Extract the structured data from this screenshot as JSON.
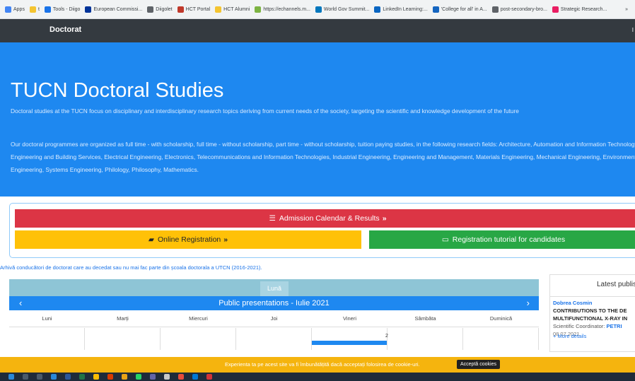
{
  "bookmarks": [
    {
      "label": "Apps",
      "icon": "apps-grid-icon",
      "color": "#4285f4"
    },
    {
      "label": "t",
      "icon": "folder-icon",
      "color": "#f4c430"
    },
    {
      "label": "Tools - Diigo",
      "icon": "diigo-icon",
      "color": "#1a73e8"
    },
    {
      "label": "European Commissi...",
      "icon": "eu-flag-icon",
      "color": "#003399"
    },
    {
      "label": "Diigolet",
      "icon": "globe-icon",
      "color": "#5f6368"
    },
    {
      "label": "HCT Portal",
      "icon": "hct-icon",
      "color": "#c0392b"
    },
    {
      "label": "HCT Alumni",
      "icon": "folder-icon",
      "color": "#f4c430"
    },
    {
      "label": "https://echannels.m...",
      "icon": "echannels-icon",
      "color": "#7cb342"
    },
    {
      "label": "World Gov Summit...",
      "icon": "wgs-icon",
      "color": "#0277bd"
    },
    {
      "label": "LinkedIn Learning:...",
      "icon": "linkedin-icon",
      "color": "#0a66c2"
    },
    {
      "label": "'College for all' in A...",
      "icon": "page-icon",
      "color": "#1565c0"
    },
    {
      "label": "post-secondary-bro...",
      "icon": "globe-icon",
      "color": "#5f6368"
    },
    {
      "label": "Strategic Research...",
      "icon": "strategic-icon",
      "color": "#e91e63"
    }
  ],
  "bookmarks_overflow": "»",
  "navbar": {
    "brand": "Doctorat",
    "edge": "I"
  },
  "hero": {
    "title": "TUCN Doctoral Studies",
    "intro": "Doctoral studies at the TUCN focus on disciplinary and interdisciplinary research topics deriving from current needs of the society, targeting the scientific and knowledge development of the future",
    "fields": "Our doctoral programmes are organized as full time - with scholarship, full time - without scholarship, part time - without scholarship, tuition paying studies, in the following research fields: Architecture, Automation and Information Technology, Civil Engineering and Building Services, Electrical Engineering, Electronics, Telecommunications and Information Technologies, Industrial Engineering, Engineering and Management, Materials Engineering, Mechanical Engineering, Environmental Engineering, Systems Engineering, Philology, Philosophy, Mathematics."
  },
  "buttons": {
    "admission": "Admission Calendar & Results",
    "online_registration": "Online Registration",
    "tutorial": "Registration tutorial for candidates",
    "chevrons": "»"
  },
  "archive_link": "Arhivă conducători de doctorat care au decedat sau nu mai fac parte din școala doctorala a UTCN (2016-2021).",
  "calendar": {
    "view_tab": "Lună",
    "title": "Public presentations - Iulie 2021",
    "prev": "‹",
    "next": "›",
    "weekdays": [
      "Luni",
      "Marți",
      "Miercuri",
      "Joi",
      "Vineri",
      "Sâmbăta",
      "Duminică"
    ],
    "visible_day": "2"
  },
  "latest": {
    "heading": "Latest publis",
    "author": "Dobrea Cosmin",
    "title_line1": "CONTRIBUTIONS TO THE DE",
    "title_line2": "MULTIFUNCTIONAL X-RAY IN",
    "coord_label": "Scientific Coordinator:",
    "coord_name": "PETRI",
    "date": "08.07.2021",
    "more": "+ More details"
  },
  "cookie": {
    "message": "Experienta ta pe acest site va fi îmbunătățită dacă acceptați folosirea de cookie-uri.",
    "accept": "Acceptă cookies"
  },
  "colors": {
    "navbar": "#343a40",
    "hero": "#1e88f0",
    "danger": "#dc3545",
    "warning": "#ffc107",
    "success": "#28a745",
    "cookie_bar": "#f5b40e"
  }
}
